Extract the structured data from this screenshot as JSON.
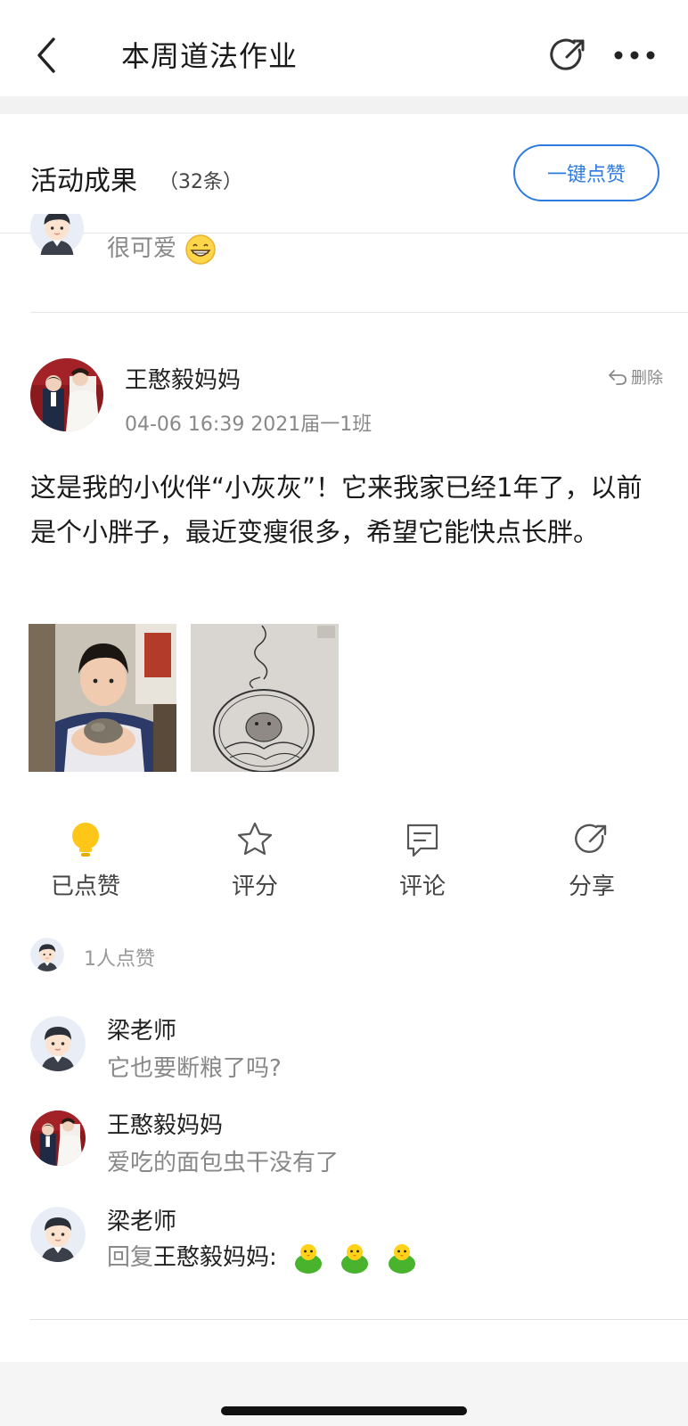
{
  "nav": {
    "title": "本周道法作业",
    "back_icon": "chevron-left-icon",
    "share_icon": "share-icon",
    "more_icon": "more-dots-icon"
  },
  "section": {
    "label": "活动成果",
    "count": "（32条）",
    "like_all_button": "一键点赞",
    "accent_color": "#2e7be0"
  },
  "previous_comment": {
    "text": "很可爱"
  },
  "post": {
    "author": "王憨毅妈妈",
    "meta": "04-06 16:39 2021届一1班",
    "delete_label": "删除",
    "text": "这是我的小伙伴“小灰灰”！它来我家已经1年了，以前是个小胖子，最近变瘦很多，希望它能快点长胖。",
    "photos": [
      "boy-holding-hamster-photo",
      "hamster-drawing-photo"
    ]
  },
  "actions": [
    {
      "label": "已点赞",
      "icon": "lightbulb-icon"
    },
    {
      "label": "评分",
      "icon": "star-icon"
    },
    {
      "label": "评论",
      "icon": "comment-icon"
    },
    {
      "label": "分享",
      "icon": "share-icon"
    }
  ],
  "likes": {
    "text": "1人点赞"
  },
  "comments": [
    {
      "name": "梁老师",
      "text": "它也要断粮了吗?"
    },
    {
      "name": "王憨毅妈妈",
      "text": "爱吃的面包虫干没有了"
    },
    {
      "name": "梁老师",
      "reply_prefix": "回复",
      "reply_to": "王憨毅妈妈",
      "reply_suffix": ":"
    }
  ]
}
